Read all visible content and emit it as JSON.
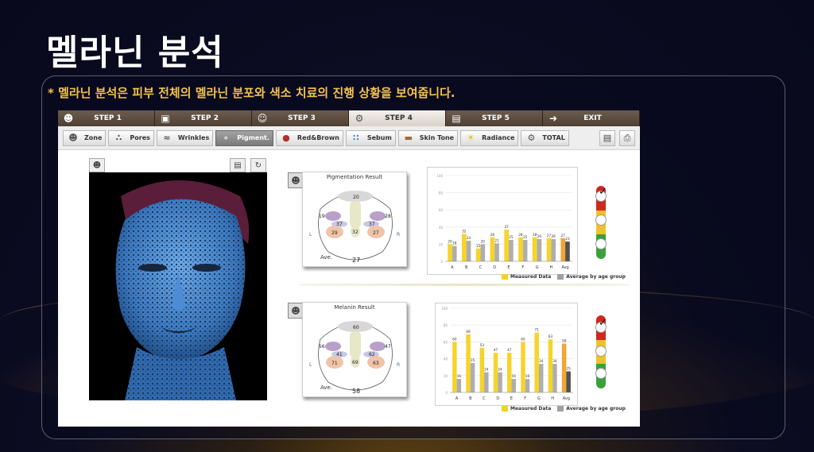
{
  "page": {
    "title": "멜라닌 분석",
    "subtitle": "* 멜라닌 분석은 피부 전체의 멜라닌 분포와 색소 치료의 진행 상황을 보여줍니다."
  },
  "colors": {
    "accent_gold": "#f2c14e",
    "bar_measured": "#f5d21f",
    "bar_average": "#a0a0a0",
    "bar_avg_highlight": "#f0a02a"
  },
  "steps": [
    {
      "label": "STEP 1",
      "icon": "person-add-icon"
    },
    {
      "label": "STEP 2",
      "icon": "camera-icon"
    },
    {
      "label": "STEP 3",
      "icon": "person-icon"
    },
    {
      "label": "STEP 4",
      "icon": "analysis-icon",
      "active": true
    },
    {
      "label": "STEP 5",
      "icon": "report-icon"
    },
    {
      "label": "EXIT",
      "icon": "exit-arrow-icon"
    }
  ],
  "tools": [
    {
      "label": "Zone",
      "icon": "zone-face-icon"
    },
    {
      "label": "Pores",
      "icon": "pores-icon"
    },
    {
      "label": "Wrinkles",
      "icon": "wrinkles-icon"
    },
    {
      "label": "Pigment.",
      "icon": "pigment-icon",
      "active": true
    },
    {
      "label": "Red&Brown",
      "icon": "red-brown-icon"
    },
    {
      "label": "Sebum",
      "icon": "sebum-icon"
    },
    {
      "label": "Skin Tone",
      "icon": "skin-tone-icon"
    },
    {
      "label": "Radiance",
      "icon": "radiance-icon"
    },
    {
      "label": "TOTAL",
      "icon": "total-icon"
    }
  ],
  "pigmentation": {
    "title": "Pigmentation Result",
    "avg_label": "Ave.",
    "avg_value": "27",
    "zone_values": {
      "forehead": "20",
      "left_eye": "19",
      "right_eye": "28",
      "left_under": "37",
      "right_under": "37",
      "nose": "32",
      "left_cheek": "29",
      "right_cheek": "27",
      "side_left": "L",
      "side_right": "R"
    }
  },
  "melanin": {
    "title": "Melanin Result",
    "avg_label": "Ave.",
    "avg_value": "58",
    "zone_values": {
      "forehead": "60",
      "left_eye": "56",
      "right_eye": "47",
      "left_under": "41",
      "right_under": "62",
      "nose": "69",
      "left_cheek": "71",
      "right_cheek": "63",
      "side_left": "L",
      "side_right": "R"
    }
  },
  "legend": {
    "measured": "Measured Data",
    "average": "Average by age group"
  },
  "chart_data": [
    {
      "type": "bar",
      "categories": [
        "A",
        "B",
        "C",
        "D",
        "E",
        "F",
        "G",
        "H",
        "Avg"
      ],
      "series": [
        {
          "name": "Measured Data",
          "values": [
            20,
            32,
            15,
            28,
            37,
            28,
            28,
            27,
            27
          ]
        },
        {
          "name": "Average by age group",
          "values": [
            18,
            24,
            20,
            21,
            25,
            25,
            26,
            26,
            23
          ]
        }
      ],
      "ylim": [
        0,
        100
      ]
    },
    {
      "type": "bar",
      "categories": [
        "A",
        "B",
        "C",
        "D",
        "E",
        "F",
        "G",
        "H",
        "Avg"
      ],
      "series": [
        {
          "name": "Measured Data",
          "values": [
            60,
            69,
            53,
            47,
            47,
            60,
            71,
            63,
            58
          ]
        },
        {
          "name": "Average by age group",
          "values": [
            16,
            35,
            24,
            24,
            16,
            16,
            34,
            34,
            25
          ]
        }
      ],
      "ylim": [
        0,
        100
      ]
    }
  ]
}
